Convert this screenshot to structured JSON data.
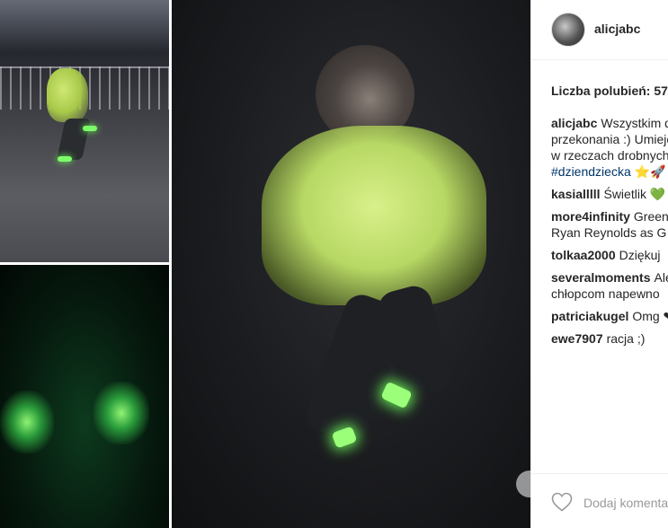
{
  "post": {
    "username": "alicjabc",
    "likes_text": "Liczba polubień: 57",
    "caption": {
      "author": "alicjabc",
      "line1": "Wszystkim d",
      "line2": "przekonania :) Umieję",
      "line3": "w rzeczach drobnych",
      "hashtag": "#dziendziecka",
      "emoji": "⭐🚀"
    },
    "comments": [
      {
        "user": "kasialllll",
        "text": "Świetlik 💚"
      },
      {
        "user": "more4infinity",
        "text": "Green",
        "line2": "Ryan Reynolds as G"
      },
      {
        "user": "tolkaa2000",
        "text": "Dziękuj"
      },
      {
        "user": "severalmoments",
        "text": "Ale",
        "line2": "chłopcom napewno"
      },
      {
        "user": "patriciakugel",
        "text": "Omg ❤"
      },
      {
        "user": "ewe7907",
        "text": "racja ;)"
      }
    ],
    "add_comment_placeholder": "Dodaj komentarz..."
  },
  "icons": {
    "like": "heart-outline-icon",
    "avatar": "avatar"
  },
  "colors": {
    "hashtag": "#003569",
    "text": "#262626",
    "muted": "#999999",
    "glow": "#7dff6a"
  }
}
